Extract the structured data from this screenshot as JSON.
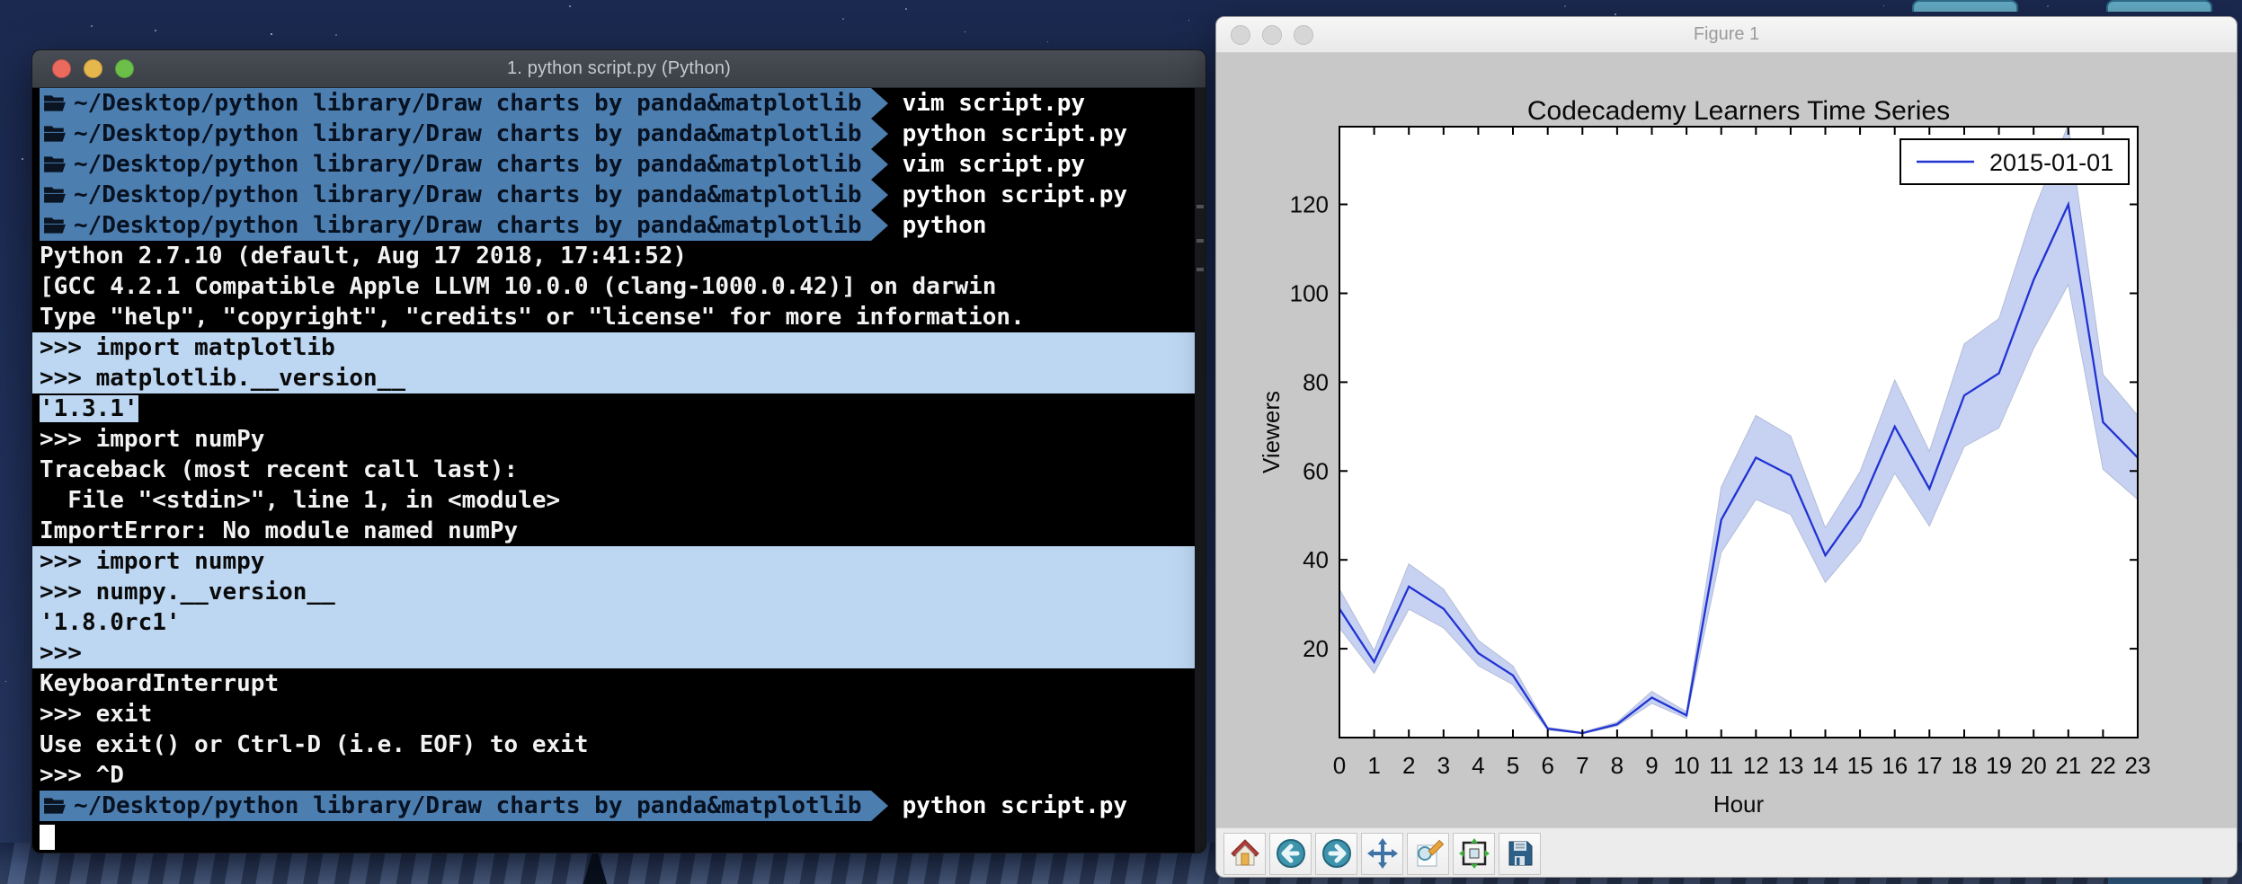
{
  "desktop": {
    "wallpaper_top_color": "#1b2950",
    "wallpaper_bottom_color": "#3a4f7a",
    "top_tab_color": "#64abc4"
  },
  "terminal": {
    "title": "1. python script.py (Python)",
    "traffic_lights": {
      "close": "#ea6a5d",
      "minimize": "#e6b74d",
      "zoom": "#6cc04a"
    },
    "prompt": {
      "path": "~/Desktop/python library/Draw charts by panda&matplotlib",
      "bar_color": "#4d7eb0"
    },
    "selection_color": "#bdd7f2",
    "lines": [
      {
        "t": "prompt",
        "cmd": "vim script.py"
      },
      {
        "t": "prompt",
        "cmd": "python script.py"
      },
      {
        "t": "prompt",
        "cmd": "vim script.py"
      },
      {
        "t": "prompt",
        "cmd": "python script.py"
      },
      {
        "t": "prompt",
        "cmd": "python"
      },
      {
        "t": "out",
        "text": "Python 2.7.10 (default, Aug 17 2018, 17:41:52)"
      },
      {
        "t": "out",
        "text": "[GCC 4.2.1 Compatible Apple LLVM 10.0.0 (clang-1000.0.42)] on darwin"
      },
      {
        "t": "out",
        "text": "Type \"help\", \"copyright\", \"credits\" or \"license\" for more information."
      },
      {
        "t": "out",
        "text": ">>> import matplotlib",
        "sel": "full"
      },
      {
        "t": "out",
        "text": ">>> matplotlib.__version__",
        "sel": "full"
      },
      {
        "t": "out",
        "text": "'1.3.1'",
        "sel": "text"
      },
      {
        "t": "out",
        "text": ">>> import numPy"
      },
      {
        "t": "out",
        "text": "Traceback (most recent call last):"
      },
      {
        "t": "out",
        "text": "  File \"<stdin>\", line 1, in <module>"
      },
      {
        "t": "out",
        "text": "ImportError: No module named numPy"
      },
      {
        "t": "out",
        "text": ">>> import numpy",
        "sel": "full"
      },
      {
        "t": "out",
        "text": ">>> numpy.__version__",
        "sel": "full"
      },
      {
        "t": "out",
        "text": "'1.8.0rc1'",
        "sel": "full"
      },
      {
        "t": "out",
        "text": ">>>",
        "sel": "full"
      },
      {
        "t": "out",
        "text": "KeyboardInterrupt"
      },
      {
        "t": "out",
        "text": ">>> exit"
      },
      {
        "t": "out",
        "text": "Use exit() or Ctrl-D (i.e. EOF) to exit"
      },
      {
        "t": "out",
        "text": ">>> ^D"
      },
      {
        "t": "prompt",
        "cmd": "python script.py"
      },
      {
        "t": "cursor"
      }
    ]
  },
  "figure_window": {
    "title": "Figure 1",
    "toolbar": {
      "buttons": [
        {
          "name": "home"
        },
        {
          "name": "back"
        },
        {
          "name": "forward"
        },
        {
          "name": "pan"
        },
        {
          "name": "zoom"
        },
        {
          "name": "subplots"
        },
        {
          "name": "save"
        }
      ]
    }
  },
  "chart_data": {
    "type": "line",
    "title": "Codecademy Learners Time Series",
    "xlabel": "Hour",
    "ylabel": "Viewers",
    "x": [
      0,
      1,
      2,
      3,
      4,
      5,
      6,
      7,
      8,
      9,
      10,
      11,
      12,
      13,
      14,
      15,
      16,
      17,
      18,
      19,
      20,
      21,
      22,
      23
    ],
    "xticks": [
      0,
      1,
      2,
      3,
      4,
      5,
      6,
      7,
      8,
      9,
      10,
      11,
      12,
      13,
      14,
      15,
      16,
      17,
      18,
      19,
      20,
      21,
      22,
      23
    ],
    "yticks": [
      20,
      40,
      60,
      80,
      100,
      120
    ],
    "xlim": [
      0,
      23
    ],
    "ylim": [
      0,
      137.5
    ],
    "grid": false,
    "legend_position": "upper right",
    "series": [
      {
        "name": "2015-01-01",
        "color": "#2133d1",
        "values": [
          29,
          17,
          34,
          29,
          19,
          14,
          2,
          1,
          3,
          9,
          5,
          49,
          63,
          59,
          41,
          52,
          70,
          56,
          77,
          82,
          103,
          120,
          71,
          63
        ],
        "band": {
          "fill": "#c7d2f3",
          "lower": [
            24.7,
            14.5,
            28.9,
            24.7,
            16.2,
            11.9,
            1.7,
            0.9,
            2.6,
            7.7,
            4.3,
            41.7,
            53.6,
            50.2,
            34.9,
            44.2,
            59.5,
            47.6,
            65.5,
            69.7,
            87.6,
            102.0,
            60.4,
            53.6
          ],
          "upper": [
            33.4,
            19.6,
            39.1,
            33.4,
            21.9,
            16.1,
            2.3,
            1.2,
            3.5,
            10.4,
            5.8,
            56.4,
            72.5,
            67.9,
            47.2,
            59.8,
            80.5,
            64.4,
            88.6,
            94.3,
            118.5,
            138.0,
            81.7,
            72.5
          ]
        }
      }
    ]
  }
}
